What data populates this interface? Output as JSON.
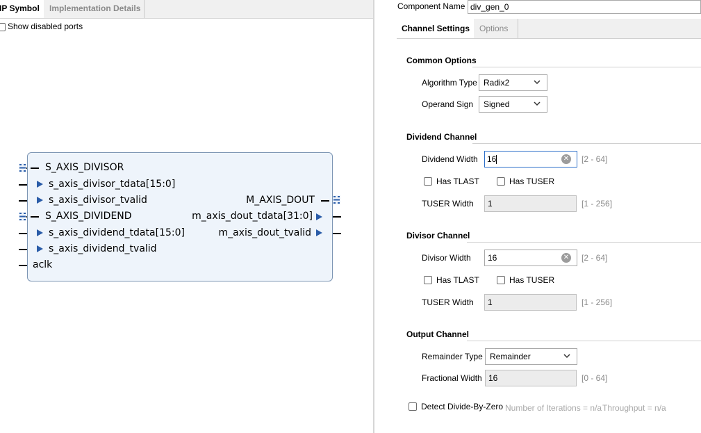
{
  "left_tabs": {
    "ip_symbol": "IP Symbol",
    "implementation_details": "Implementation Details"
  },
  "show_disabled_ports": {
    "label": "Show disabled ports",
    "checked": false
  },
  "ip_symbol": {
    "bus_s_axis_divisor": "S_AXIS_DIVISOR",
    "port_s_axis_divisor_tdata": "s_axis_divisor_tdata[15:0]",
    "port_s_axis_divisor_tvalid": "s_axis_divisor_tvalid",
    "bus_s_axis_dividend": "S_AXIS_DIVIDEND",
    "port_s_axis_dividend_tdata": "s_axis_dividend_tdata[15:0]",
    "port_s_axis_dividend_tvalid": "s_axis_dividend_tvalid",
    "port_aclk": "aclk",
    "bus_m_axis_dout": "M_AXIS_DOUT",
    "port_m_axis_dout_tdata": "m_axis_dout_tdata[31:0]",
    "port_m_axis_dout_tvalid": "m_axis_dout_tvalid"
  },
  "component_name": {
    "label": "Component Name",
    "value": "div_gen_0"
  },
  "right_tabs": {
    "channel_settings": "Channel Settings",
    "options": "Options"
  },
  "common_options": {
    "title": "Common Options",
    "algorithm_type": {
      "label": "Algorithm Type",
      "value": "Radix2"
    },
    "operand_sign": {
      "label": "Operand Sign",
      "value": "Signed"
    }
  },
  "dividend_channel": {
    "title": "Dividend Channel",
    "width": {
      "label": "Dividend Width",
      "value": "16",
      "range": "[2 - 64]"
    },
    "has_tlast": {
      "label": "Has TLAST",
      "checked": false
    },
    "has_tuser": {
      "label": "Has TUSER",
      "checked": false
    },
    "tuser_width": {
      "label": "TUSER Width",
      "value": "1",
      "range": "[1 - 256]"
    }
  },
  "divisor_channel": {
    "title": "Divisor Channel",
    "width": {
      "label": "Divisor Width",
      "value": "16",
      "range": "[2 - 64]"
    },
    "has_tlast": {
      "label": "Has TLAST",
      "checked": false
    },
    "has_tuser": {
      "label": "Has TUSER",
      "checked": false
    },
    "tuser_width": {
      "label": "TUSER Width",
      "value": "1",
      "range": "[1 - 256]"
    }
  },
  "output_channel": {
    "title": "Output Channel",
    "remainder_type": {
      "label": "Remainder Type",
      "value": "Remainder"
    },
    "fractional_width": {
      "label": "Fractional Width",
      "value": "16",
      "range": "[0 - 64]"
    }
  },
  "detect_divide_by_zero": {
    "label": "Detect Divide-By-Zero",
    "checked": false
  },
  "iterations_info": "Number of Iterations = n/a",
  "throughput_info": "Throughput = n/a",
  "colors": {
    "accent": "#2a5ca8",
    "block_fill": "#eef4fb",
    "block_border": "#7d96b4",
    "focus": "#2d6fc9"
  },
  "icons": {
    "bus": "bus-interface-icon",
    "port_arrow": "port-arrow-icon",
    "clear": "clear-icon",
    "dropdown": "chevron-down-icon"
  }
}
